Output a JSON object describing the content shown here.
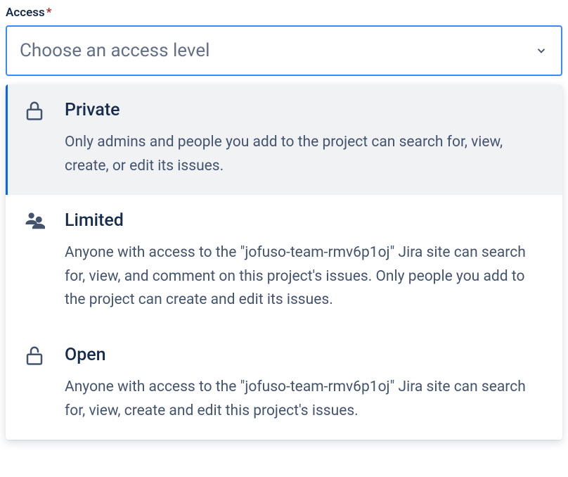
{
  "field": {
    "label": "Access",
    "required_marker": "*",
    "placeholder": "Choose an access level"
  },
  "options": [
    {
      "icon": "lock-closed-icon",
      "title": "Private",
      "desc": "Only admins and people you add to the project can search for, view, create, or edit its issues."
    },
    {
      "icon": "people-icon",
      "title": "Limited",
      "desc": "Anyone with access to the \"jofuso-team-rmv6p1oj\" Jira site can search for, view, and comment on this project's issues. Only people you add to the project can create and edit its issues."
    },
    {
      "icon": "lock-open-icon",
      "title": "Open",
      "desc": "Anyone with access to the \"jofuso-team-rmv6p1oj\" Jira site can search for, view, create and edit this project's issues."
    }
  ]
}
